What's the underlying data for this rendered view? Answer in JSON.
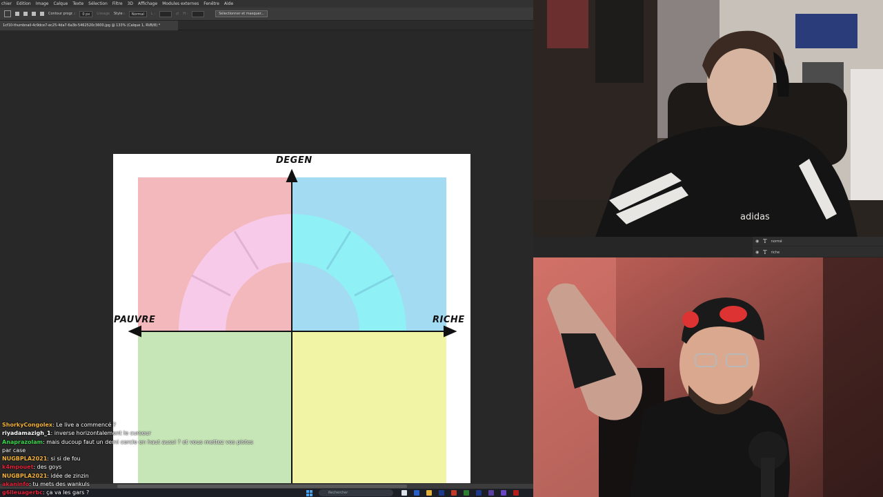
{
  "menu": {
    "items": [
      "chier",
      "Edition",
      "Image",
      "Calque",
      "Texte",
      "Sélection",
      "Filtre",
      "3D",
      "Affichage",
      "Modules externes",
      "Fenêtre",
      "Aide"
    ]
  },
  "options": {
    "contour_label": "Contour progr. :",
    "contour_value": "0 px",
    "lissage_label": "Lissage",
    "style_label": "Style :",
    "style_value": "Normal",
    "l_label": "L :",
    "h_label": "H :",
    "select_mask_button": "Sélectionner et masquer..."
  },
  "document": {
    "tab_title": "1cf10-thumbnail-4c9dce7-ec25-4da7-6a3b-5462520c3600.jpg @ 133% (Calque 1, RVB/8) *"
  },
  "chart": {
    "top_label": "DEGEN",
    "left_label": "PAUVRE",
    "right_label": "RICHE",
    "colors": {
      "top_left": "#f2b8bc",
      "top_right": "#a3dcf2",
      "bottom_left": "#c7e6b8",
      "bottom_right": "#f1f4a4"
    }
  },
  "chat": {
    "messages": [
      {
        "user": "ShorkyCongolex",
        "color": "#f4b33a",
        "text": "Le live a commencé ?"
      },
      {
        "user": "riyadamazigh_1",
        "color": "#ffffff",
        "text": "inverse horizontalement le curseur"
      },
      {
        "user": "Anaprazolam",
        "color": "#39d64b",
        "text": "mais ducoup faut un demi cercle en haut aussi ? et vous mettez vos pistes"
      },
      {
        "user": "",
        "color": "#ffffff",
        "text": "par case"
      },
      {
        "user": "NUGBPLA2021",
        "color": "#f4b33a",
        "text": "si si de fou"
      },
      {
        "user": "k4mpouet",
        "color": "#e0243a",
        "text": "des goys"
      },
      {
        "user": "NUGBPLA2021",
        "color": "#f4b33a",
        "text": "idée de zinzin"
      },
      {
        "user": "akaninfo",
        "color": "#e0243a",
        "text": "tu mets des wankuls"
      },
      {
        "user": "g6lleuagerbc",
        "color": "#e0243a",
        "text": "ça va les gars ?"
      }
    ]
  },
  "layers": {
    "rows": [
      "normé",
      "riche"
    ]
  },
  "taskbar": {
    "search_placeholder": "Rechercher"
  }
}
